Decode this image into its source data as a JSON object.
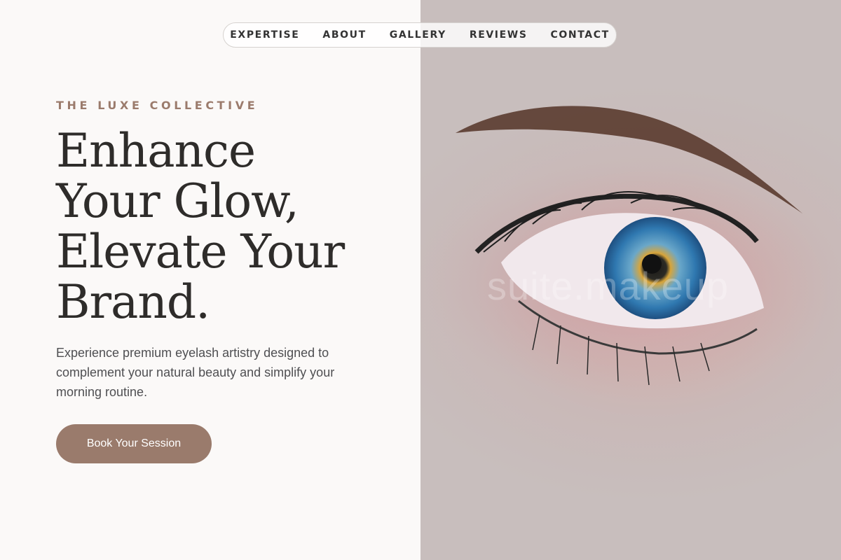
{
  "nav": {
    "items": [
      "EXPERTISE",
      "ABOUT",
      "GALLERY",
      "REVIEWS",
      "CONTACT"
    ]
  },
  "hero": {
    "eyebrow": "THE LUXE COLLECTIVE",
    "headline": [
      "Enhance",
      "Your Glow,",
      "Elevate Your",
      "Brand."
    ],
    "description": "Experience premium eyelash artistry designed to complement your natural beauty and simplify your morning routine.",
    "cta_label": "Book Your Session"
  },
  "image": {
    "watermark": "suite.makeup"
  },
  "colors": {
    "accent": "#9a7b6c",
    "background": "#fbf9f8",
    "heading": "#2e2c2a",
    "body_text": "#4f4f52"
  }
}
